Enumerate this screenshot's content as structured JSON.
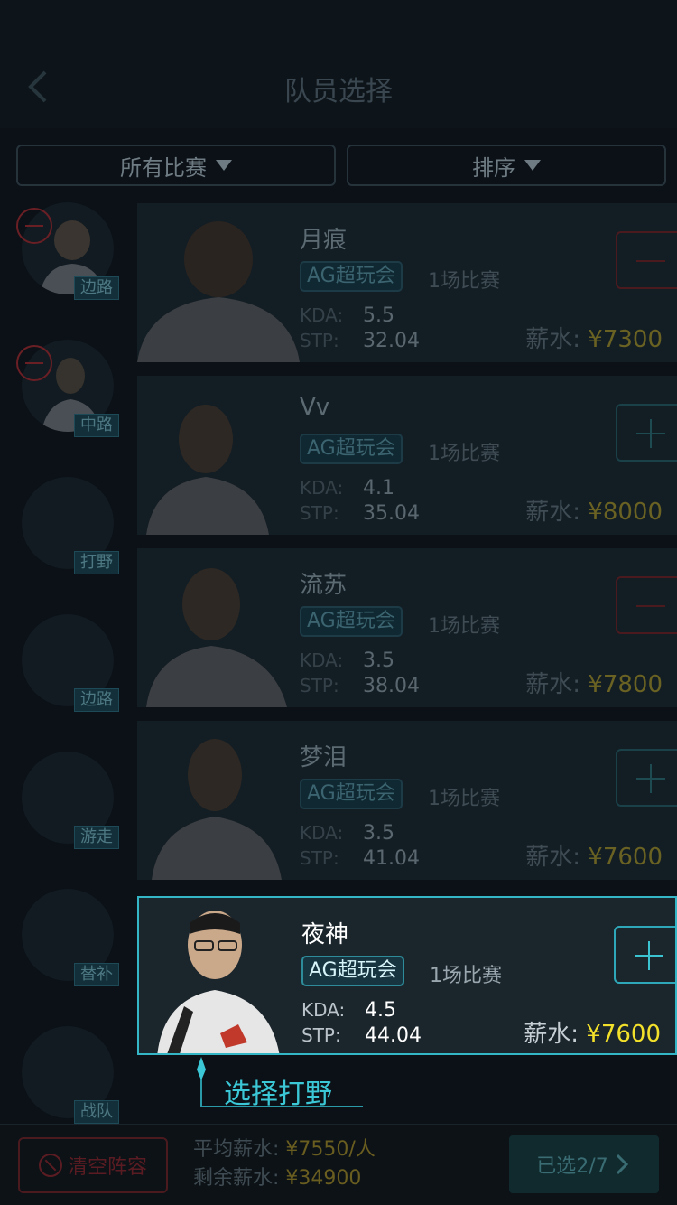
{
  "header": {
    "title": "队员选择"
  },
  "filters": {
    "match_label": "所有比赛",
    "sort_label": "排序"
  },
  "positions": [
    {
      "label": "边路",
      "removable": true
    },
    {
      "label": "中路",
      "removable": true
    },
    {
      "label": "打野",
      "removable": false
    },
    {
      "label": "边路",
      "removable": false
    },
    {
      "label": "游走",
      "removable": false
    },
    {
      "label": "替补",
      "removable": false
    },
    {
      "label": "战队",
      "removable": false
    }
  ],
  "players": [
    {
      "name": "月痕",
      "team": "AG超玩会",
      "matches": "1场比赛",
      "kda_label": "KDA:",
      "kda": "5.5",
      "stp_label": "STP:",
      "stp": "32.04",
      "salary_label": "薪水:",
      "salary": "¥7300",
      "action": "minus"
    },
    {
      "name": "Vv",
      "team": "AG超玩会",
      "matches": "1场比赛",
      "kda_label": "KDA:",
      "kda": "4.1",
      "stp_label": "STP:",
      "stp": "35.04",
      "salary_label": "薪水:",
      "salary": "¥8000",
      "action": "plus"
    },
    {
      "name": "流苏",
      "team": "AG超玩会",
      "matches": "1场比赛",
      "kda_label": "KDA:",
      "kda": "3.5",
      "stp_label": "STP:",
      "stp": "38.04",
      "salary_label": "薪水:",
      "salary": "¥7800",
      "action": "minus"
    },
    {
      "name": "梦泪",
      "team": "AG超玩会",
      "matches": "1场比赛",
      "kda_label": "KDA:",
      "kda": "3.5",
      "stp_label": "STP:",
      "stp": "41.04",
      "salary_label": "薪水:",
      "salary": "¥7600",
      "action": "plus"
    },
    {
      "name": "夜神",
      "team": "AG超玩会",
      "matches": "1场比赛",
      "kda_label": "KDA:",
      "kda": "4.5",
      "stp_label": "STP:",
      "stp": "44.04",
      "salary_label": "薪水:",
      "salary": "¥7600",
      "action": "plus"
    }
  ],
  "guide": {
    "text": "选择打野"
  },
  "footer": {
    "clear_label": "清空阵容",
    "avg_label": "平均薪水:",
    "avg_value": "¥7550/人",
    "remain_label": "剩余薪水:",
    "remain_value": "¥34900",
    "confirm_label": "已选2/7"
  },
  "colors": {
    "accent": "#34b6c7",
    "salary": "#f2e02a",
    "danger": "#6a1f25"
  }
}
